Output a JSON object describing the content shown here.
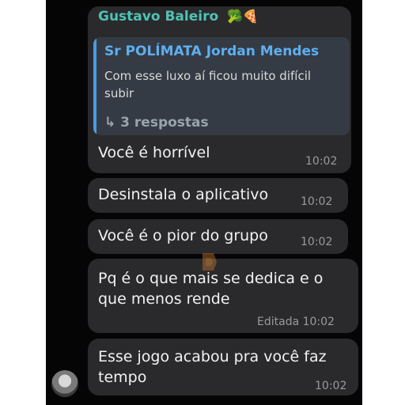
{
  "group_message": {
    "sender": "Gustavo Baleiro",
    "sender_emoji": "🥦🍕",
    "quote": {
      "name": "Sr POLÍMATA Jordan Mendes",
      "text": "Com esse luxo aí ficou muito difícil subir",
      "replies": "↳ 3 respostas"
    },
    "text": "Você é horrível",
    "time": "10:02"
  },
  "messages": [
    {
      "text": "Desinstala o aplicativo",
      "time": "10:02"
    },
    {
      "text": "Você é o pior do grupo",
      "time": "10:02"
    },
    {
      "text": "Pq é o que mais se dedica e o\nque menos rende",
      "time": "Editada 10:02"
    },
    {
      "text": "Esse jogo acabou pra você faz\ntempo",
      "time": "10:02"
    }
  ],
  "colors": {
    "background": "#050505",
    "bubble": "#2a2a2c",
    "sender_name": "#4fc2b4",
    "quote_name": "#5eaff0",
    "quote_bar": "#4a9cdd"
  }
}
